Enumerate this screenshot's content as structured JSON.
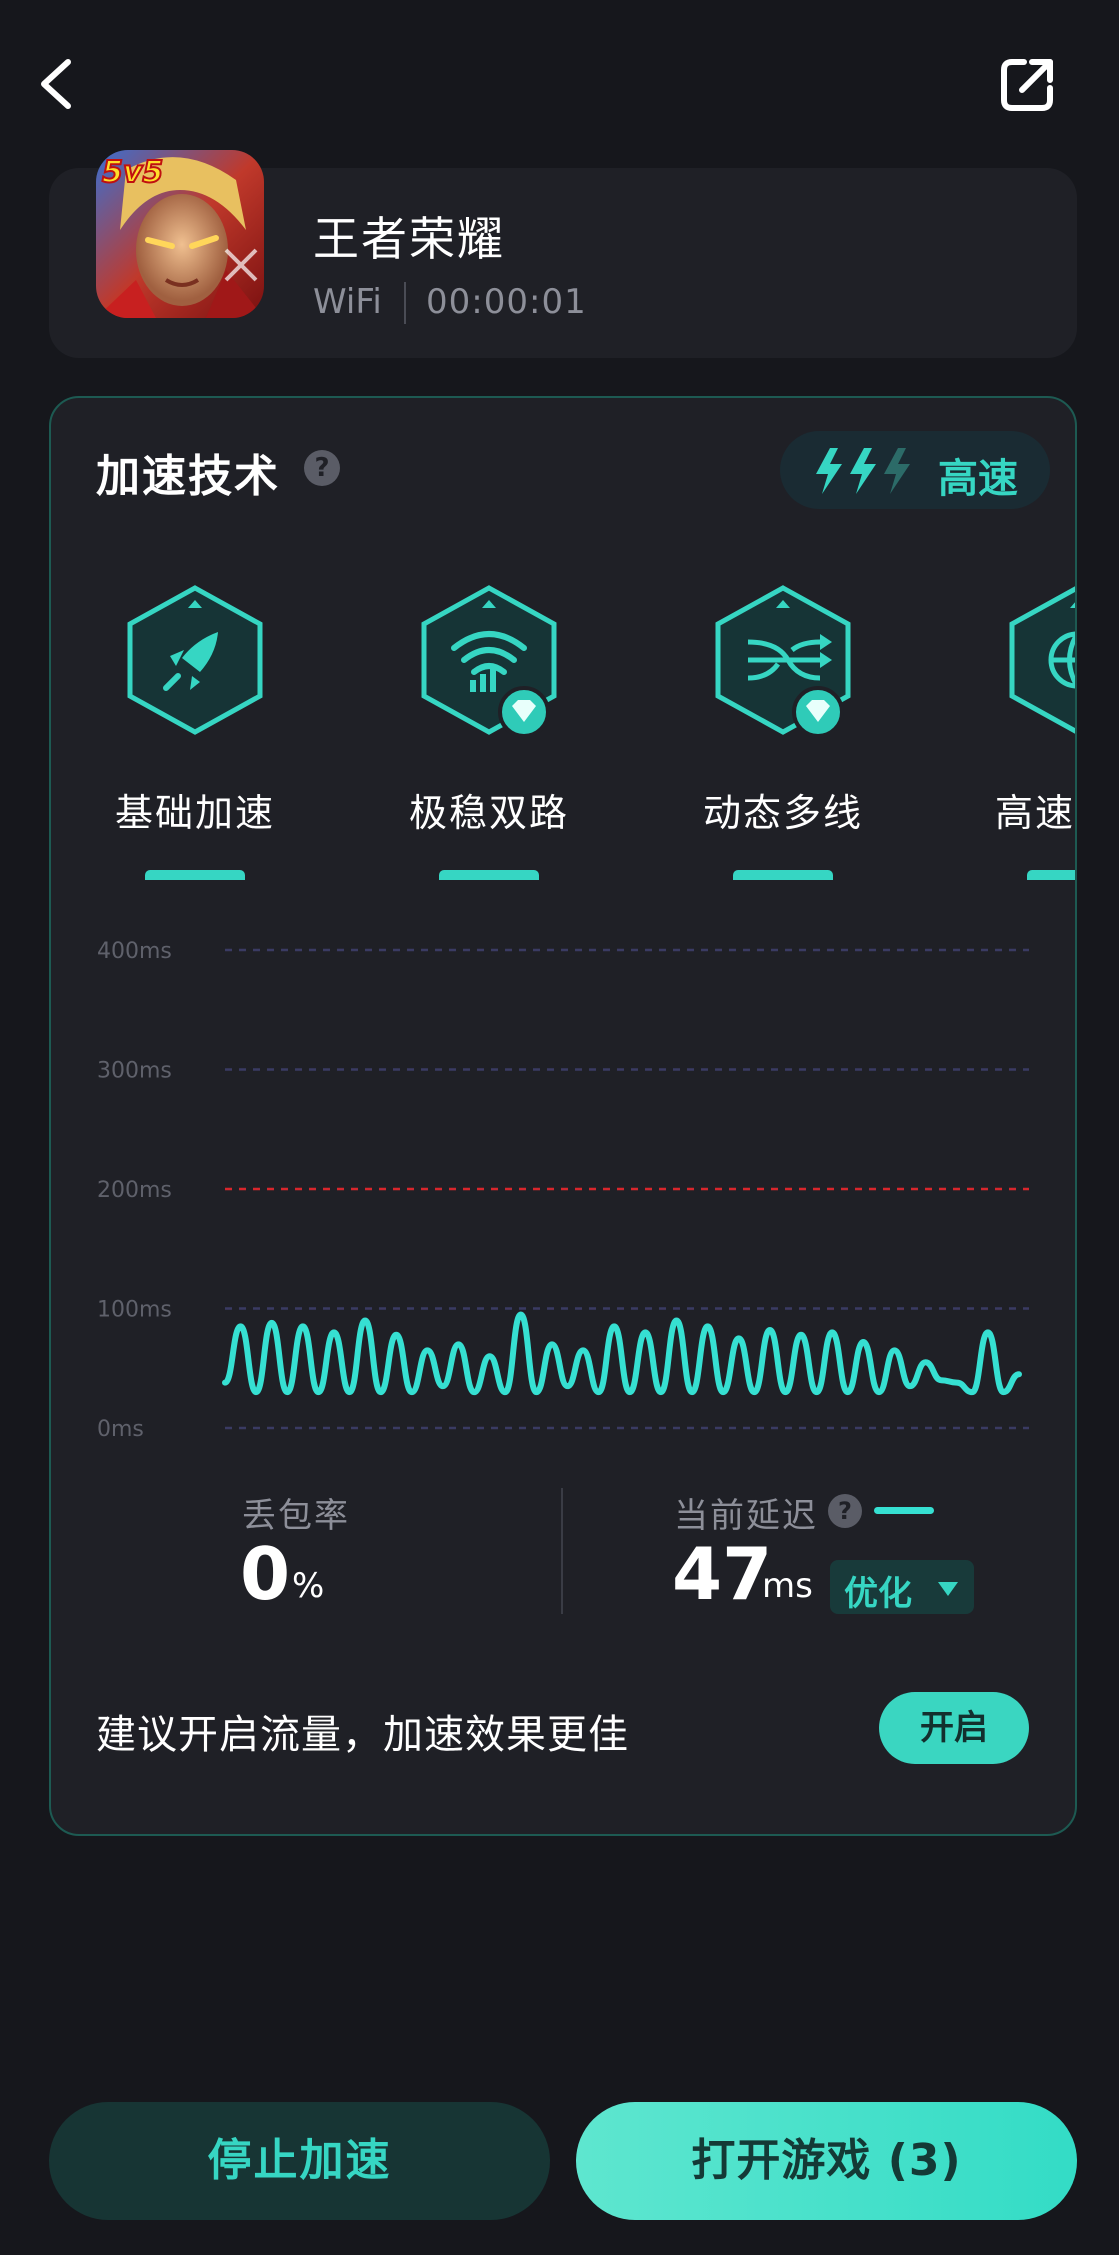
{
  "game": {
    "name": "王者荣耀",
    "network": "WiFi",
    "timer": "00:00:01",
    "icon_badge": "5v5"
  },
  "tech": {
    "title": "加速技术",
    "speed_label": "高速",
    "items": [
      {
        "label": "基础加速",
        "icon": "rocket-icon",
        "premium": false
      },
      {
        "label": "极稳双路",
        "icon": "wifi-signal-icon",
        "premium": true
      },
      {
        "label": "动态多线",
        "icon": "multiline-arrows-icon",
        "premium": true
      },
      {
        "label": "高速",
        "icon": "globe-icon",
        "premium": false
      }
    ]
  },
  "chart_data": {
    "type": "line",
    "y_ticks": [
      "400ms",
      "300ms",
      "200ms",
      "100ms",
      "0ms"
    ],
    "ylim": [
      0,
      400
    ],
    "threshold": 200,
    "series": [
      {
        "values": [
          38,
          85,
          30,
          88,
          30,
          85,
          30,
          80,
          30,
          90,
          30,
          78,
          30,
          65,
          35,
          70,
          30,
          60,
          30,
          95,
          30,
          70,
          35,
          65,
          30,
          85,
          30,
          80,
          30,
          90,
          30,
          85,
          30,
          75,
          30,
          82,
          30,
          78,
          30,
          80,
          30,
          72,
          30,
          65,
          35,
          55,
          40,
          38,
          30,
          80,
          30,
          45
        ]
      }
    ],
    "colors": {
      "line": "#36e0d2",
      "grid": "#3a3b63",
      "threshold": "#d8262c"
    }
  },
  "stats": {
    "loss_label": "丢包率",
    "loss_value": "0",
    "loss_unit": "%",
    "latency_label": "当前延迟",
    "latency_value": "47",
    "latency_unit": "ms",
    "optimize_label": "优化"
  },
  "suggest": {
    "text": "建议开启流量，加速效果更佳",
    "button": "开启"
  },
  "actions": {
    "stop": "停止加速",
    "open": "打开游戏 (3)"
  },
  "colors": {
    "accent": "#36d6c3",
    "background": "#16171c",
    "card": "#1f2026"
  }
}
